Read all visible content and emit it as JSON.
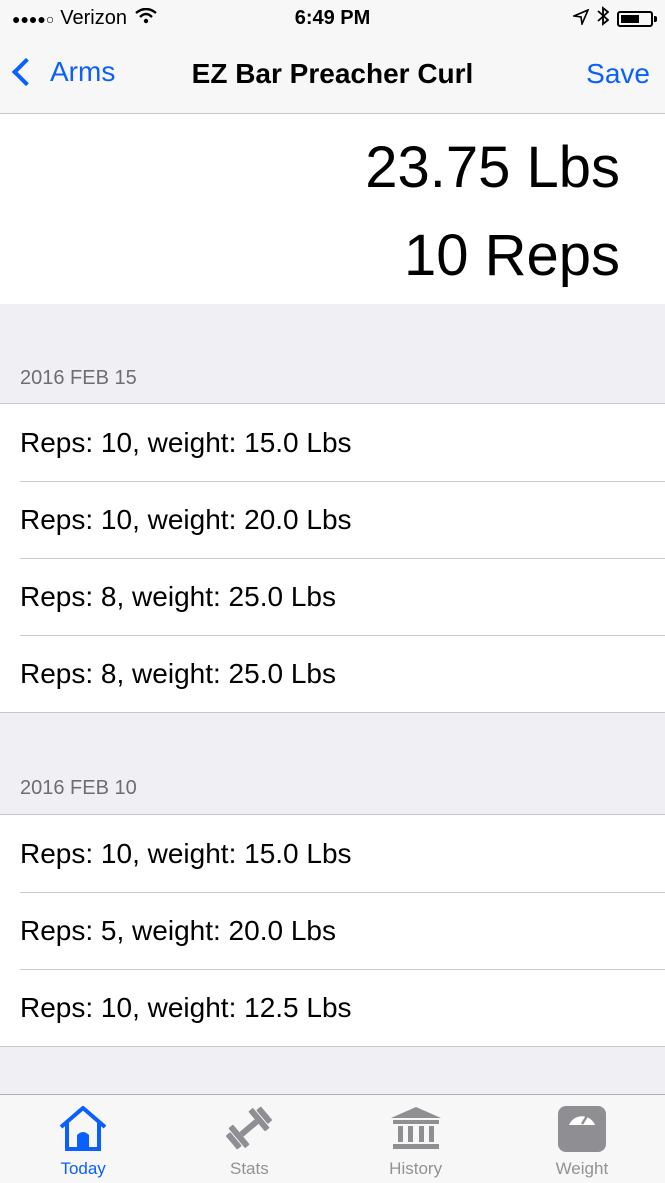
{
  "status_bar": {
    "carrier": "Verizon",
    "time": "6:49 PM"
  },
  "nav": {
    "back_label": "Arms",
    "title": "EZ Bar Preacher Curl",
    "save_label": "Save"
  },
  "current": {
    "weight": "23.75 Lbs",
    "reps": "10 Reps"
  },
  "sections": [
    {
      "header": "2016 FEB 15",
      "rows": [
        "Reps: 10, weight: 15.0 Lbs",
        "Reps: 10, weight: 20.0 Lbs",
        "Reps: 8, weight: 25.0 Lbs",
        "Reps: 8, weight: 25.0 Lbs"
      ]
    },
    {
      "header": "2016 FEB 10",
      "rows": [
        "Reps: 10, weight: 15.0 Lbs",
        "Reps: 5, weight: 20.0 Lbs",
        "Reps: 10, weight: 12.5 Lbs"
      ]
    }
  ],
  "tabs": [
    {
      "label": "Today",
      "icon": "home-icon",
      "active": true
    },
    {
      "label": "Stats",
      "icon": "dumbbell-icon",
      "active": false
    },
    {
      "label": "History",
      "icon": "bank-icon",
      "active": false
    },
    {
      "label": "Weight",
      "icon": "scale-icon",
      "active": false
    }
  ],
  "colors": {
    "accent": "#0a60fe",
    "inactive": "#929292",
    "group_bg": "#efeff4"
  }
}
